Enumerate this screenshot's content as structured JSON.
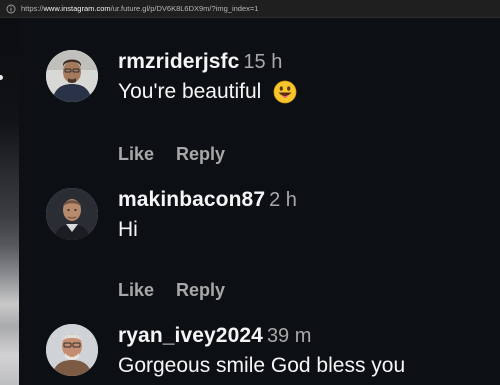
{
  "address_bar": {
    "scheme": "https://",
    "domain": "www.instagram.com",
    "path": "/ur.future.gl/p/DV6K8L6DX9m/?img_index=1"
  },
  "comments": [
    {
      "username": "rmzriderjsfc",
      "time": "15 h",
      "text": "You're beautiful",
      "emoji": "grinning-face-with-tongue-emoji",
      "like_label": "Like",
      "reply_label": "Reply"
    },
    {
      "username": "makinbacon87",
      "time": "2 h",
      "text": "Hi",
      "like_label": "Like",
      "reply_label": "Reply"
    },
    {
      "username": "ryan_ivey2024",
      "time": "39 m",
      "text": "Gorgeous smile God bless you"
    }
  ],
  "colors": {
    "background": "#0c0f14",
    "primary_text": "#f5f5f5",
    "secondary_text": "#a8a8a8"
  }
}
